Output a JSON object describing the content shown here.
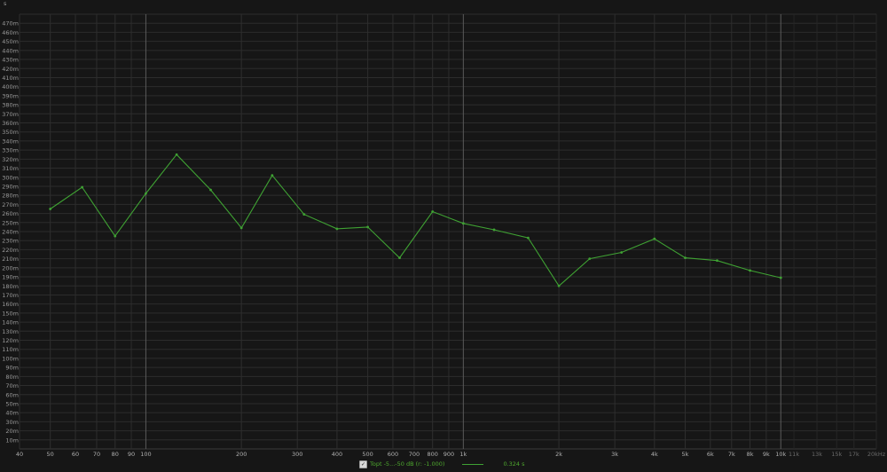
{
  "chart_data": {
    "type": "line",
    "x_scale": "log",
    "xlim": [
      40,
      20000
    ],
    "ylim": [
      0,
      480
    ],
    "y_unit": "s",
    "grid": true,
    "x_ticks_major": [
      {
        "value": 40,
        "label": "40"
      },
      {
        "value": 50,
        "label": "50"
      },
      {
        "value": 60,
        "label": "60"
      },
      {
        "value": 70,
        "label": "70"
      },
      {
        "value": 80,
        "label": "80"
      },
      {
        "value": 90,
        "label": "90"
      },
      {
        "value": 100,
        "label": "100"
      },
      {
        "value": 200,
        "label": "200"
      },
      {
        "value": 300,
        "label": "300"
      },
      {
        "value": 400,
        "label": "400"
      },
      {
        "value": 500,
        "label": "500"
      },
      {
        "value": 600,
        "label": "600"
      },
      {
        "value": 700,
        "label": "700"
      },
      {
        "value": 800,
        "label": "800"
      },
      {
        "value": 900,
        "label": "900"
      },
      {
        "value": 1000,
        "label": "1k"
      },
      {
        "value": 2000,
        "label": "2k"
      },
      {
        "value": 3000,
        "label": "3k"
      },
      {
        "value": 4000,
        "label": "4k"
      },
      {
        "value": 5000,
        "label": "5k"
      },
      {
        "value": 6000,
        "label": "6k"
      },
      {
        "value": 7000,
        "label": "7k"
      },
      {
        "value": 8000,
        "label": "8k"
      },
      {
        "value": 9000,
        "label": "9k"
      },
      {
        "value": 10000,
        "label": "10k"
      }
    ],
    "x_ticks_minor": [
      {
        "value": 11000,
        "label": "11k"
      },
      {
        "value": 13000,
        "label": "13k"
      },
      {
        "value": 15000,
        "label": "15k"
      },
      {
        "value": 17000,
        "label": "17k"
      },
      {
        "value": 20000,
        "label": "20kHz"
      }
    ],
    "y_tick_step": 10,
    "y_tick_suffix": "m",
    "series": [
      {
        "name": "0.324 s",
        "color": "#3fa233",
        "points": [
          [
            50,
            265
          ],
          [
            63,
            289
          ],
          [
            80,
            235
          ],
          [
            100,
            282
          ],
          [
            125,
            325
          ],
          [
            160,
            286
          ],
          [
            200,
            244
          ],
          [
            250,
            302
          ],
          [
            315,
            259
          ],
          [
            400,
            243
          ],
          [
            500,
            245
          ],
          [
            630,
            211
          ],
          [
            800,
            262
          ],
          [
            1000,
            249
          ],
          [
            1250,
            242
          ],
          [
            1600,
            233
          ],
          [
            2000,
            180
          ],
          [
            2500,
            210
          ],
          [
            3150,
            217
          ],
          [
            4000,
            232
          ],
          [
            5000,
            211
          ],
          [
            6300,
            208
          ],
          [
            8000,
            197
          ],
          [
            10000,
            189
          ]
        ]
      }
    ]
  },
  "legend": {
    "checked": true,
    "check_glyph": "✓",
    "filter_label": "Topt -5...-50 dB (r: -1.000)",
    "series_label": "0.324 s"
  }
}
